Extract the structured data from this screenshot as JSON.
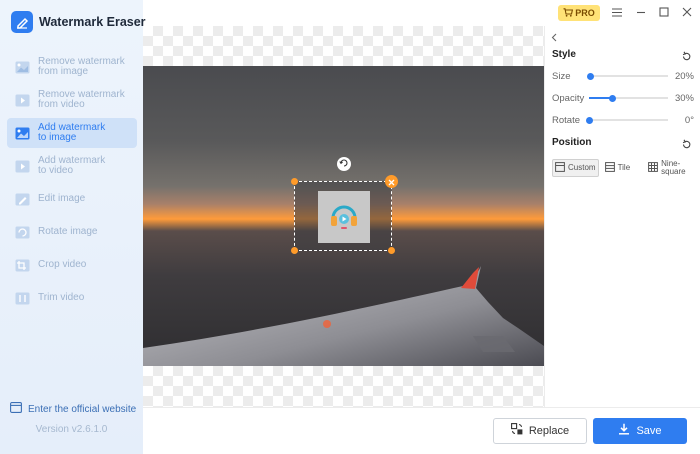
{
  "app": {
    "title": "Watermark Eraser",
    "version": "Version v2.6.1.0",
    "accent": "#2f7df0"
  },
  "sidebar": {
    "items": [
      {
        "label": "Remove watermark\nfrom image",
        "icon": "image-eraser-icon",
        "active": false
      },
      {
        "label": "Remove watermark\nfrom video",
        "icon": "video-eraser-icon",
        "active": false
      },
      {
        "label": "Add watermark\nto image",
        "icon": "image-add-icon",
        "active": true
      },
      {
        "label": "Add watermark\nto video",
        "icon": "video-add-icon",
        "active": false
      },
      {
        "label": "Edit image",
        "icon": "image-edit-icon",
        "active": false
      },
      {
        "label": "Rotate image",
        "icon": "rotate-image-icon",
        "active": false
      },
      {
        "label": "Crop video",
        "icon": "crop-video-icon",
        "active": false
      },
      {
        "label": "Trim video",
        "icon": "trim-video-icon",
        "active": false
      }
    ],
    "official_link": "Enter the official website"
  },
  "topbar": {
    "pro_label": "PRO",
    "pro_color": "#ffe277"
  },
  "panel": {
    "style_title": "Style",
    "sliders": [
      {
        "label": "Size",
        "value": "20%",
        "fraction": 0.02
      },
      {
        "label": "Opacity",
        "value": "30%",
        "fraction": 0.3
      },
      {
        "label": "Rotate",
        "value": "0°",
        "fraction": 0
      }
    ],
    "position_title": "Position",
    "positions": [
      {
        "label": "Custom",
        "icon": "custom-position-icon",
        "active": true
      },
      {
        "label": "Tile",
        "icon": "tile-icon",
        "active": false
      },
      {
        "label": "Nine-\nsquare",
        "icon": "nine-square-icon",
        "active": false
      }
    ]
  },
  "actions": {
    "replace_label": "Replace",
    "save_label": "Save"
  }
}
